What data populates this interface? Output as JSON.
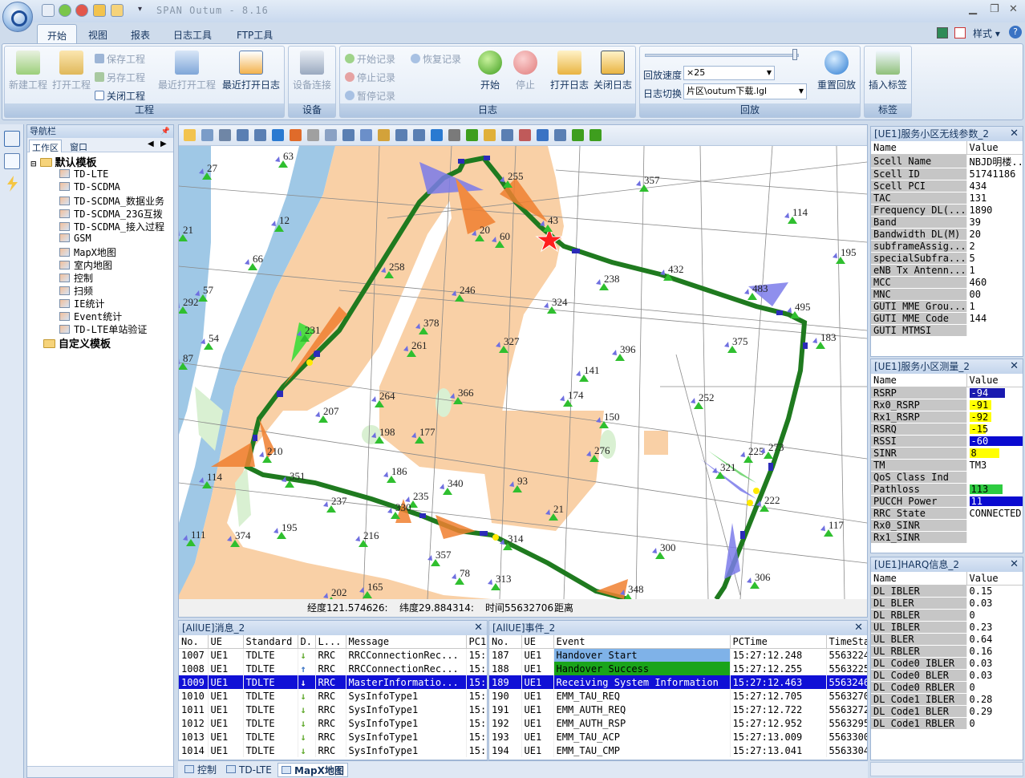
{
  "window": {
    "title": "SPAN Outum - 8.16"
  },
  "ribbon": {
    "tabs": [
      "开始",
      "视图",
      "报表",
      "日志工具",
      "FTP工具"
    ],
    "style_label": "样式",
    "groups": {
      "project": {
        "label": "工程",
        "new": "新建工程",
        "open": "打开工程",
        "save": "保存工程",
        "save_as": "另存工程",
        "close": "关闭工程",
        "recent_project": "最近打开工程",
        "recent_log": "最近打开日志"
      },
      "device": {
        "label": "设备",
        "connect": "设备连接"
      },
      "log": {
        "label": "日志",
        "start_record": "开始记录",
        "stop_record": "停止记录",
        "pause_record": "暂停记录",
        "resume_record": "恢复记录",
        "start": "开始",
        "stop": "停止",
        "open_log": "打开日志",
        "close_log": "关闭日志"
      },
      "playback": {
        "label": "回放",
        "speed_label": "回放速度",
        "speed_value": "×25",
        "switch_label": "日志切换",
        "switch_value": "片区\\outum下载.lgl",
        "replay": "重置回放"
      },
      "tags": {
        "label": "标签",
        "insert": "插入标签"
      }
    }
  },
  "nav": {
    "title": "导航栏",
    "tabs": [
      "工作区",
      "窗口"
    ],
    "default_folder": "默认模板",
    "items": [
      "TD-LTE",
      "TD-SCDMA",
      "TD-SCDMA_数据业务",
      "TD-SCDMA_23G互拨",
      "TD-SCDMA_接入过程",
      "GSM",
      "MapX地图",
      "室内地图",
      "控制",
      "扫频",
      "IE统计",
      "Event统计",
      "TD-LTE单站验证"
    ],
    "custom_folder": "自定义模板"
  },
  "map": {
    "site_labels": [
      "63",
      "27",
      "255",
      "357",
      "43",
      "12",
      "20",
      "60",
      "114",
      "21",
      "66",
      "195",
      "258",
      "432",
      "57",
      "238",
      "246",
      "483",
      "292",
      "324",
      "495",
      "378",
      "183",
      "54",
      "231",
      "261",
      "327",
      "375",
      "396",
      "87",
      "141",
      "264",
      "174",
      "366",
      "252",
      "150",
      "207",
      "198",
      "177",
      "276",
      "225",
      "273",
      "210",
      "186",
      "351",
      "114",
      "93",
      "321",
      "340",
      "235",
      "222",
      "237",
      "330",
      "21",
      "117",
      "111",
      "374",
      "195",
      "216",
      "314",
      "300",
      "357",
      "78",
      "313",
      "306",
      "202",
      "165",
      "348"
    ],
    "status": {
      "lon": "经度121.574626:",
      "lat": "纬度29.884314:",
      "time": "时间55632706",
      "dist": "距离"
    }
  },
  "messages": {
    "title": "[AllUE]消息_2",
    "columns": [
      "No.",
      "UE",
      "Standard",
      "D.",
      "L...",
      "Message",
      "PC1"
    ],
    "rows": [
      {
        "no": "1007",
        "ue": "UE1",
        "std": "TDLTE",
        "dir": "↓",
        "layer": "RRC",
        "msg": "RRCConnectionRec...",
        "pc": "15:"
      },
      {
        "no": "1008",
        "ue": "UE1",
        "std": "TDLTE",
        "dir": "↑",
        "layer": "RRC",
        "msg": "RRCConnectionRec...",
        "pc": "15:"
      },
      {
        "no": "1009",
        "ue": "UE1",
        "std": "TDLTE",
        "dir": "↓",
        "layer": "RRC",
        "msg": "MasterInformatio...",
        "pc": "15:"
      },
      {
        "no": "1010",
        "ue": "UE1",
        "std": "TDLTE",
        "dir": "↓",
        "layer": "RRC",
        "msg": "SysInfoType1",
        "pc": "15:"
      },
      {
        "no": "1011",
        "ue": "UE1",
        "std": "TDLTE",
        "dir": "↓",
        "layer": "RRC",
        "msg": "SysInfoType1",
        "pc": "15:"
      },
      {
        "no": "1012",
        "ue": "UE1",
        "std": "TDLTE",
        "dir": "↓",
        "layer": "RRC",
        "msg": "SysInfoType1",
        "pc": "15:"
      },
      {
        "no": "1013",
        "ue": "UE1",
        "std": "TDLTE",
        "dir": "↓",
        "layer": "RRC",
        "msg": "SysInfoType1",
        "pc": "15:"
      },
      {
        "no": "1014",
        "ue": "UE1",
        "std": "TDLTE",
        "dir": "↓",
        "layer": "RRC",
        "msg": "SysInfoType1",
        "pc": "15:"
      }
    ]
  },
  "events": {
    "title": "[AllUE]事件_2",
    "columns": [
      "No.",
      "UE",
      "Event",
      "PCTime",
      "TimeSta"
    ],
    "rows": [
      {
        "no": "187",
        "ue": "UE1",
        "event": "Handover Start",
        "pctime": "15:27:12.248",
        "ts": "5563224"
      },
      {
        "no": "188",
        "ue": "UE1",
        "event": "Handover Success",
        "pctime": "15:27:12.255",
        "ts": "5563225"
      },
      {
        "no": "189",
        "ue": "UE1",
        "event": "Receiving System Information",
        "pctime": "15:27:12.463",
        "ts": "5563246"
      },
      {
        "no": "190",
        "ue": "UE1",
        "event": "EMM_TAU_REQ",
        "pctime": "15:27:12.705",
        "ts": "5563270"
      },
      {
        "no": "191",
        "ue": "UE1",
        "event": "EMM_AUTH_REQ",
        "pctime": "15:27:12.722",
        "ts": "5563272"
      },
      {
        "no": "192",
        "ue": "UE1",
        "event": "EMM_AUTH_RSP",
        "pctime": "15:27:12.952",
        "ts": "5563295"
      },
      {
        "no": "193",
        "ue": "UE1",
        "event": "EMM_TAU_ACP",
        "pctime": "15:27:13.009",
        "ts": "5563300"
      },
      {
        "no": "194",
        "ue": "UE1",
        "event": "EMM_TAU_CMP",
        "pctime": "15:27:13.041",
        "ts": "5563304"
      }
    ]
  },
  "panels": {
    "radio": {
      "title": "[UE1]服务小区无线参数_2",
      "columns": [
        "Name",
        "Value"
      ],
      "rows": [
        [
          "Scell Name",
          "NBJD明楼..."
        ],
        [
          "Scell ID",
          "51741186"
        ],
        [
          "Scell PCI",
          "434"
        ],
        [
          "TAC",
          "131"
        ],
        [
          "Frequency DL(...",
          "1890"
        ],
        [
          "Band",
          "39"
        ],
        [
          "Bandwidth DL(M)",
          "20"
        ],
        [
          "subframeAssig...",
          "2"
        ],
        [
          "specialSubfra...",
          "5"
        ],
        [
          "eNB Tx Antenn...",
          "1"
        ],
        [
          "MCC",
          "460"
        ],
        [
          "MNC",
          "00"
        ],
        [
          "GUTI MME Grou...",
          "1"
        ],
        [
          "GUTI MME Code",
          "144"
        ],
        [
          "GUTI MTMSI",
          ""
        ]
      ]
    },
    "measure": {
      "title": "[UE1]服务小区测量_2",
      "columns": [
        "Name",
        "Value"
      ],
      "rows": [
        {
          "name": "RSRP",
          "value": "-94",
          "color": "#1a1ab0",
          "fill": 0.65
        },
        {
          "name": "Rx0_RSRP",
          "value": "-91",
          "color": "#ffff00",
          "fill": 0.4
        },
        {
          "name": "Rx1_RSRP",
          "value": "-92",
          "color": "#ffff00",
          "fill": 0.4
        },
        {
          "name": "RSRQ",
          "value": "-15",
          "color": "#ffff00",
          "fill": 0.3
        },
        {
          "name": "RSSI",
          "value": "-60",
          "color": "#0a0ad0",
          "fill": 1.0
        },
        {
          "name": "SINR",
          "value": "8",
          "color": "#ffff00",
          "fill": 0.55
        },
        {
          "name": "TM",
          "value": "TM3",
          "color": "",
          "fill": 0
        },
        {
          "name": "QoS Class Ind",
          "value": "",
          "color": "",
          "fill": 0
        },
        {
          "name": "Pathloss",
          "value": "113",
          "color": "#2ecc40",
          "fill": 0.6
        },
        {
          "name": "PUCCH Power",
          "value": "11",
          "color": "#0a0ad0",
          "fill": 1.0
        },
        {
          "name": "RRC State",
          "value": "CONNECTED",
          "color": "",
          "fill": 0
        },
        {
          "name": "Rx0_SINR",
          "value": "",
          "color": "",
          "fill": 0
        },
        {
          "name": "Rx1_SINR",
          "value": "",
          "color": "",
          "fill": 0
        }
      ]
    },
    "harq": {
      "title": "[UE1]HARQ信息_2",
      "columns": [
        "Name",
        "Value"
      ],
      "rows": [
        [
          "DL IBLER",
          "0.15"
        ],
        [
          "DL BLER",
          "0.03"
        ],
        [
          "DL RBLER",
          "0"
        ],
        [
          "UL IBLER",
          "0.23"
        ],
        [
          "UL BLER",
          "0.64"
        ],
        [
          "UL RBLER",
          "0.16"
        ],
        [
          "DL Code0 IBLER",
          "0.03"
        ],
        [
          "DL Code0 BLER",
          "0.03"
        ],
        [
          "DL Code0 RBLER",
          "0"
        ],
        [
          "DL Code1 IBLER",
          "0.28"
        ],
        [
          "DL Code1 BLER",
          "0.29"
        ],
        [
          "DL Code1 RBLER",
          "0"
        ]
      ]
    }
  },
  "bottom_tabs": [
    "控制",
    "TD-LTE",
    "MapX地图"
  ]
}
